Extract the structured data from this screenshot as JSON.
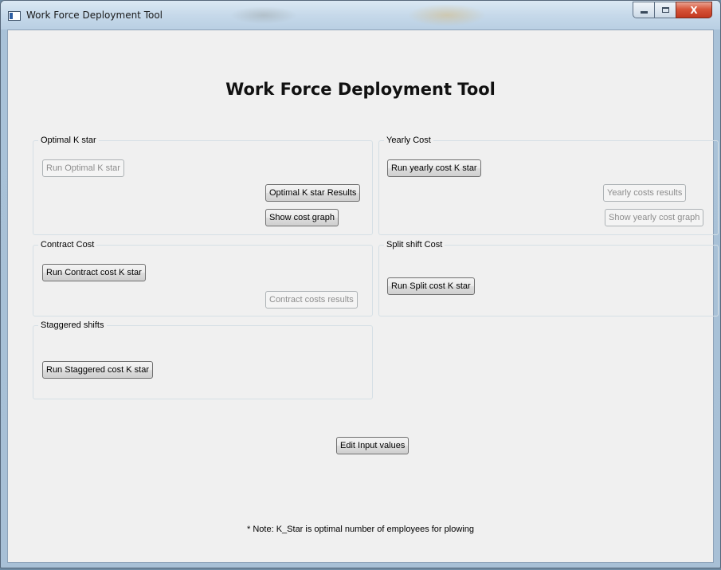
{
  "window": {
    "title": "Work Force Deployment Tool",
    "controls": {
      "close_glyph": "X"
    }
  },
  "main": {
    "heading": "Work Force Deployment Tool",
    "note": "* Note: K_Star is optimal number of employees for plowing"
  },
  "groups": {
    "optimal": {
      "label": "Optimal K star",
      "run_button": "Run Optimal K star",
      "results_button": "Optimal K star Results",
      "graph_button": "Show cost graph"
    },
    "yearly": {
      "label": "Yearly Cost",
      "run_button": "Run yearly cost K star",
      "results_button": "Yearly costs results",
      "graph_button": "Show yearly cost graph"
    },
    "contract": {
      "label": "Contract Cost",
      "run_button": "Run Contract cost K star",
      "results_button": "Contract costs results"
    },
    "split": {
      "label": "Split shift Cost",
      "run_button": "Run Split cost K star"
    },
    "staggered": {
      "label": "Staggered shifts",
      "run_button": "Run Staggered cost K star"
    }
  },
  "actions": {
    "edit_inputs_button": "Edit Input values"
  },
  "icons": {
    "app": "app-window-icon",
    "minimize": "minimize-icon",
    "maximize": "maximize-icon",
    "close": "close-icon"
  }
}
